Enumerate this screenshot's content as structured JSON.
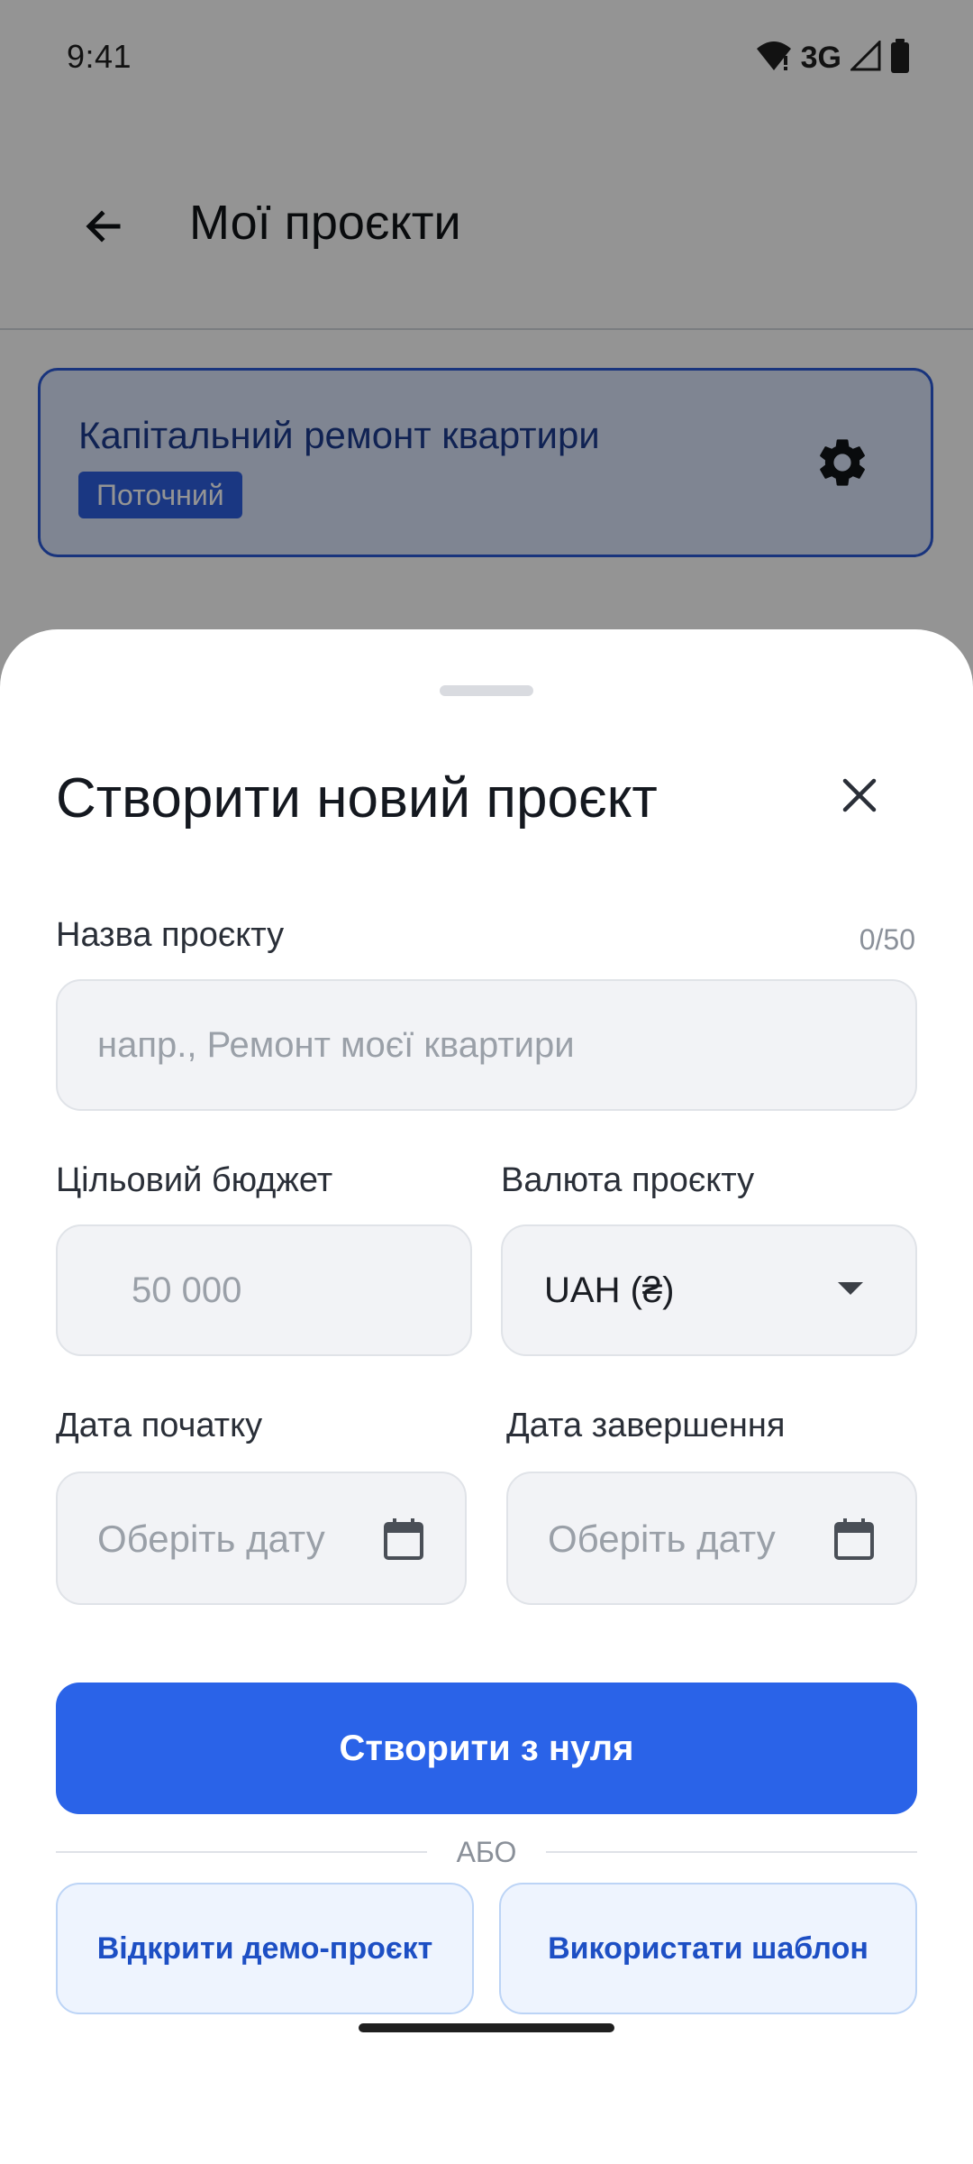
{
  "status_bar": {
    "time": "9:41",
    "network": "3G",
    "icons": [
      "wifi-icon",
      "signal-icon",
      "battery-icon"
    ]
  },
  "app_bar": {
    "title": "Мої проєкти",
    "back_icon": "arrow-left-icon"
  },
  "project_card": {
    "name": "Капітальний ремонт квартири",
    "badge": "Поточний",
    "settings_icon": "gear-icon"
  },
  "sheet": {
    "title": "Створити новий проєкт",
    "close_icon": "close-icon",
    "name_field": {
      "label": "Назва проєкту",
      "counter": "0/50",
      "placeholder": "напр., Ремонт моєї квартири",
      "value": ""
    },
    "budget_field": {
      "label": "Цільовий бюджет",
      "placeholder": "50 000",
      "value": ""
    },
    "currency_field": {
      "label": "Валюта проєкту",
      "value": "UAH (₴)"
    },
    "start_date_field": {
      "label": "Дата початку",
      "placeholder": "Оберіть дату",
      "icon": "calendar-icon"
    },
    "end_date_field": {
      "label": "Дата завершення",
      "placeholder": "Оберіть дату",
      "icon": "calendar-icon"
    },
    "create_button": "Створити з нуля",
    "divider_text": "АБО",
    "demo_button": "Відкрити демо-проєкт",
    "template_button": "Використати шаблон"
  },
  "colors": {
    "primary": "#2a63e8",
    "card_border": "#2b5bd7",
    "badge_bg": "#2d5fe0",
    "secondary_button_text": "#1d4fc4"
  }
}
